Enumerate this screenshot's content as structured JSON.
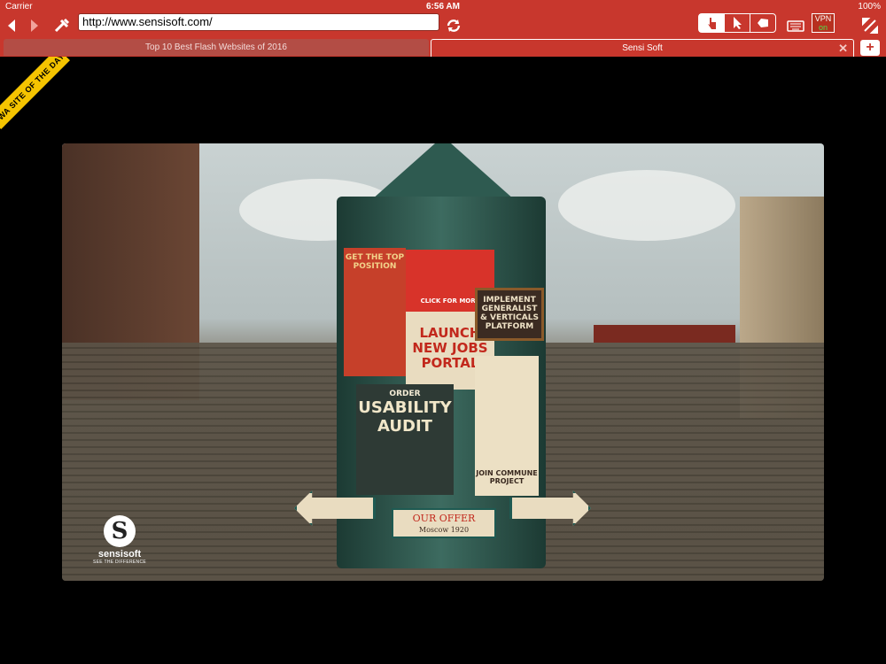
{
  "status_bar": {
    "carrier": "Carrier",
    "time": "6:56 AM",
    "battery": "100%"
  },
  "toolbar": {
    "url": "http://www.sensisoft.com/",
    "back_icon": "back-arrow-icon",
    "forward_icon": "forward-arrow-icon",
    "vpn_label": "VPN",
    "vpn_state": "on"
  },
  "tabs": [
    {
      "title": "Top 10 Best Flash Websites of 2016",
      "active": false
    },
    {
      "title": "Sensi Soft",
      "active": true
    }
  ],
  "page": {
    "ribbon": "FWA SITE OF THE DAY",
    "posters": {
      "p1": "GET THE TOP POSITION",
      "p2": "CLICK FOR MORE",
      "p3": "LAUNCH NEW JOBS PORTAL",
      "p4": "IMPLEMENT GENERALIST & VERTICALS PLATFORM",
      "p5_top": "ORDER",
      "p5_big": "USABILITY AUDIT",
      "p6": "JOIN COMMUNE PROJECT"
    },
    "offer_title": "OUR OFFER",
    "offer_sub": "Moscow 1920",
    "logo_name": "sensisoft",
    "logo_tag": "SEE THE DIFFERENCE"
  },
  "colors": {
    "accent": "#c8372d",
    "column": "#2e5a50"
  }
}
